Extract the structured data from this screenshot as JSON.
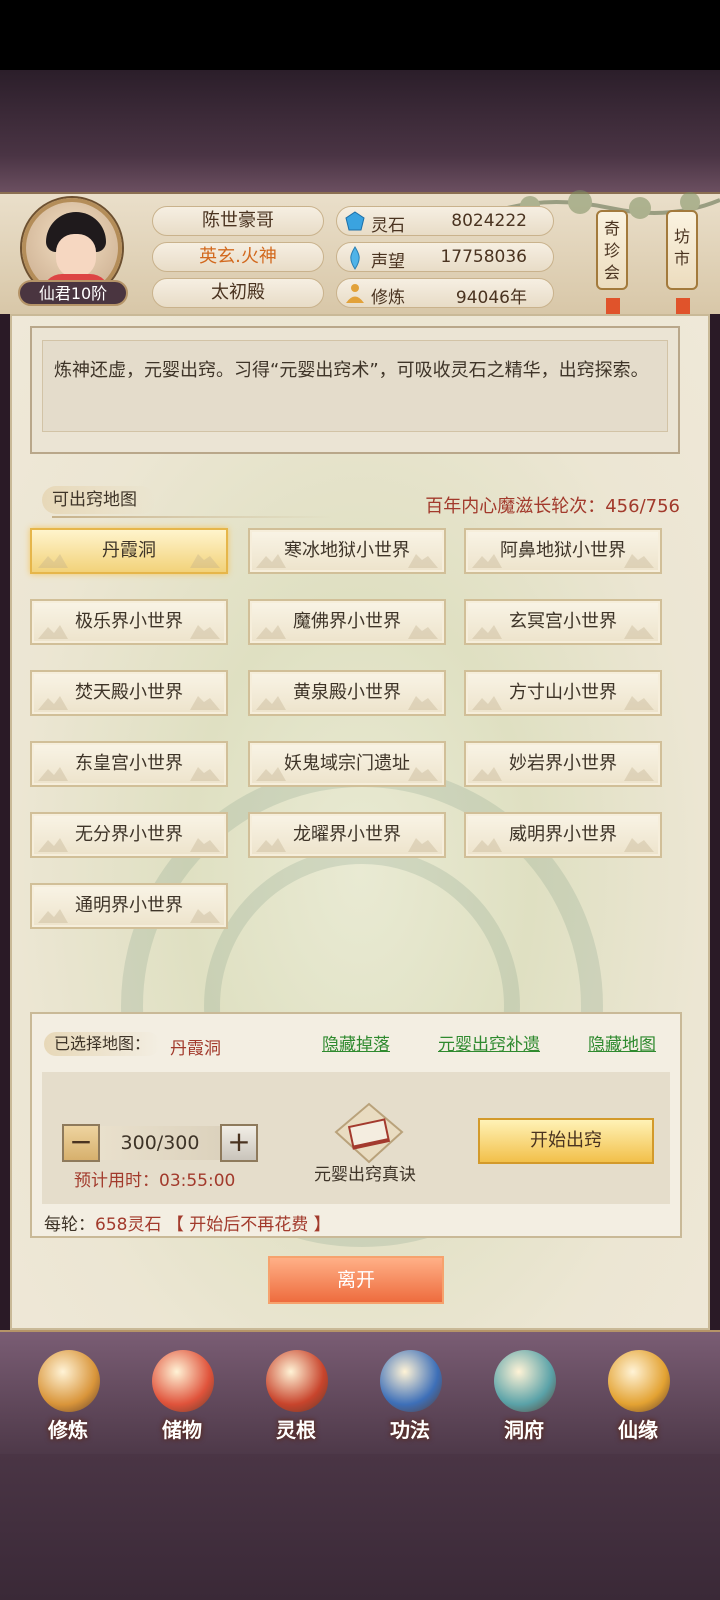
{
  "player": {
    "rank": "仙君10阶",
    "name": "陈世豪哥",
    "title": "英玄.火神",
    "palace": "太初殿"
  },
  "stats": [
    {
      "icon": "spirit-stone-icon",
      "label": "灵石",
      "value": "8024222"
    },
    {
      "icon": "reputation-icon",
      "label": "声望",
      "value": "17758036"
    },
    {
      "icon": "cultivation-icon",
      "label": "修炼",
      "value": "94046年"
    }
  ],
  "side_buttons": [
    {
      "label": "奇珍会"
    },
    {
      "label": "坊市"
    }
  ],
  "description": "炼神还虚，元婴出窍。习得“元婴出窍术”，可吸收灵石之精华，出窍探索。",
  "map_section": {
    "label": "可出窍地图",
    "round_info": "百年内心魔滋长轮次：456/756"
  },
  "maps": [
    "丹霞洞",
    "寒冰地狱小世界",
    "阿鼻地狱小世界",
    "极乐界小世界",
    "魔佛界小世界",
    "玄冥宫小世界",
    "焚天殿小世界",
    "黄泉殿小世界",
    "方寸山小世界",
    "东皇宫小世界",
    "妖鬼域宗门遗址",
    "妙岩界小世界",
    "无分界小世界",
    "龙曜界小世界",
    "威明界小世界",
    "通明界小世界"
  ],
  "selected_map_index": 0,
  "selection": {
    "label": "已选择地图：",
    "value": "丹霞洞",
    "links": [
      "隐藏掉落",
      "元婴出窍补遗",
      "隐藏地图"
    ],
    "count": "300/300",
    "minus": "−",
    "plus": "+",
    "est_time": "预计用时：03:55:00",
    "book_label": "元婴出窍真诀",
    "start_label": "开始出窍",
    "cost_prefix": "每轮：",
    "cost_value": "658灵石",
    "cost_note": "【 开始后不再花费 】"
  },
  "leave_label": "离开",
  "nav": [
    {
      "label": "修炼",
      "icon": "cultivate-icon",
      "color": "#d9953a"
    },
    {
      "label": "储物",
      "icon": "storage-bag-icon",
      "color": "#e0533b"
    },
    {
      "label": "灵根",
      "icon": "spirit-root-icon",
      "color": "#c8442c"
    },
    {
      "label": "功法",
      "icon": "skill-book-icon",
      "color": "#3d6fb8"
    },
    {
      "label": "洞府",
      "icon": "cave-dwelling-icon",
      "color": "#5aa2a8"
    },
    {
      "label": "仙缘",
      "icon": "immortal-fate-icon",
      "color": "#e3a232"
    }
  ]
}
